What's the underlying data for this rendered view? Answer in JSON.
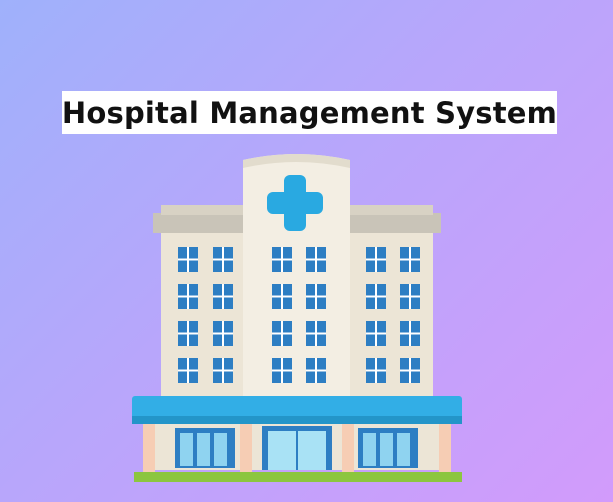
{
  "title": "Hospital Management System",
  "colors": {
    "background_start": "#9fb1fb",
    "background_end": "#d29bfb",
    "building": "#ece5d6",
    "tower": "#f3eee3",
    "ledge": "#c9c4b8",
    "window": "#2d7ec3",
    "cross": "#29a9e1",
    "canopy": "#32aee6",
    "pillar": "#f6cdb4",
    "grass": "#8cc63f"
  },
  "icons": {
    "medical_cross": "plus-cross-icon",
    "building": "hospital-building-icon"
  }
}
